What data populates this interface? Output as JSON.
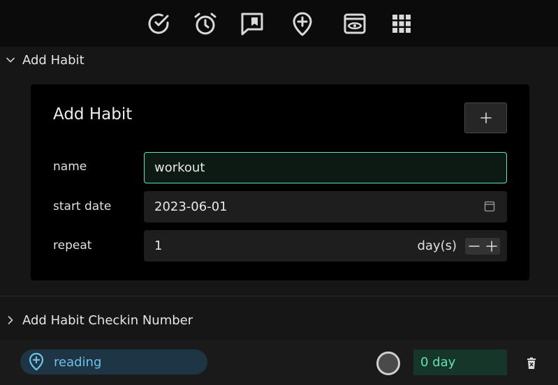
{
  "toolbar": {
    "icons": [
      "check-circle-icon",
      "alarm-clock-icon",
      "comment-bookmark-icon",
      "location-add-icon",
      "eye-window-icon",
      "grid-apps-icon"
    ]
  },
  "section1": {
    "title": "Add Habit",
    "expanded": true
  },
  "form": {
    "title": "Add Habit",
    "add_button": "+",
    "name_label": "name",
    "name_value": "workout",
    "start_date_label": "start date",
    "start_date_value": "2023-06-01",
    "repeat_label": "repeat",
    "repeat_value": "1",
    "repeat_unit": "day(s)"
  },
  "section2": {
    "title": "Add Habit Checkin Number",
    "expanded": false
  },
  "habits": [
    {
      "name": "reading",
      "streak": "0 day"
    }
  ],
  "colors": {
    "accent_green": "#63e2b7",
    "accent_blue": "#70c0e8",
    "background": "#161616"
  }
}
